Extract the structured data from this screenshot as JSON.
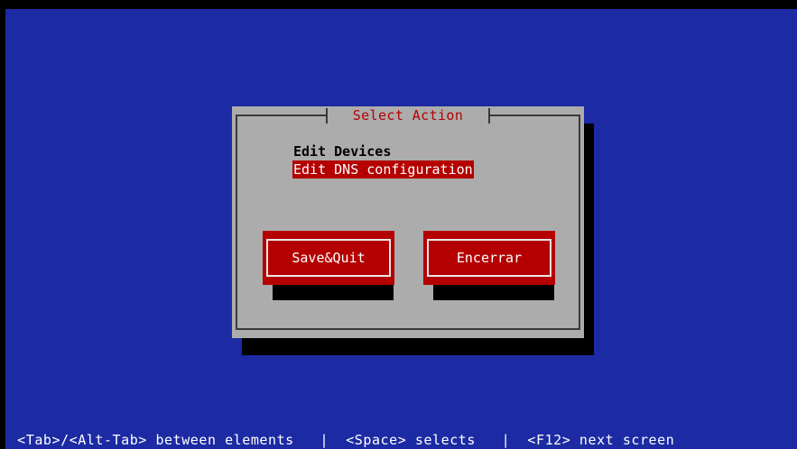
{
  "dialog": {
    "title": "Select Action",
    "actions": [
      {
        "label": "Edit Devices",
        "selected": false
      },
      {
        "label": "Edit DNS configuration",
        "selected": true
      }
    ],
    "buttons": {
      "save_quit": "Save&Quit",
      "quit": "Encerrar"
    }
  },
  "help_line": "  <Tab>/<Alt-Tab> between elements   |  <Space> selects   |  <F12> next screen",
  "colors": {
    "background": "#1c2aa4",
    "dialog": "#acacac",
    "accent": "#b40000",
    "shadow": "#000000"
  }
}
